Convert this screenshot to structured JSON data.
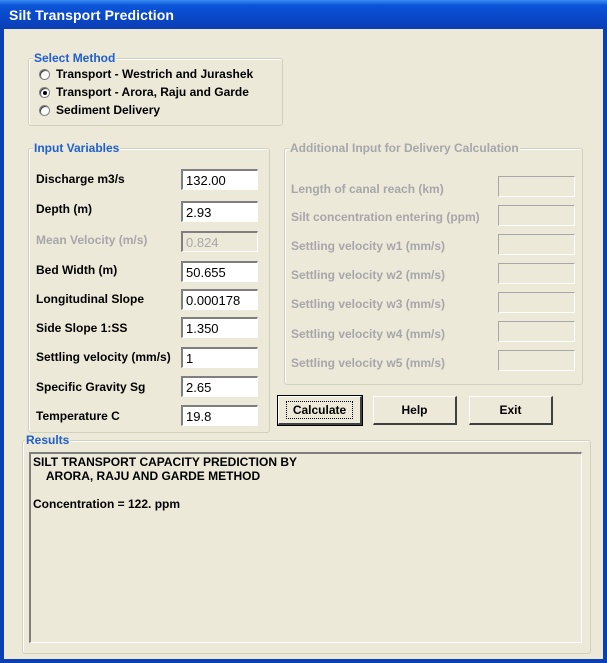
{
  "window": {
    "title": "Silt Transport Prediction"
  },
  "method": {
    "legend": "Select Method",
    "options": [
      {
        "label": "Transport - Westrich and Jurashek",
        "selected": false
      },
      {
        "label": "Transport - Arora, Raju and Garde",
        "selected": true
      },
      {
        "label": "Sediment Delivery",
        "selected": false
      }
    ]
  },
  "inputs": {
    "legend": "Input Variables",
    "fields": [
      {
        "label": "Discharge m3/s",
        "value": "132.00",
        "enabled": true
      },
      {
        "label": "Depth (m)",
        "value": "2.93",
        "enabled": true
      },
      {
        "label": "Mean Velocity (m/s)",
        "value": "0.824",
        "enabled": false
      },
      {
        "label": "Bed Width (m)",
        "value": "50.655",
        "enabled": true
      },
      {
        "label": "Longitudinal Slope",
        "value": "0.000178",
        "enabled": true
      },
      {
        "label": "Side Slope 1:SS",
        "value": "1.350",
        "enabled": true
      },
      {
        "label": "Settling velocity (mm/s)",
        "value": "1",
        "enabled": true
      },
      {
        "label": "Specific Gravity Sg",
        "value": "2.65",
        "enabled": true
      },
      {
        "label": "Temperature C",
        "value": "19.8",
        "enabled": true
      }
    ]
  },
  "delivery": {
    "legend": "Additional Input for Delivery Calculation",
    "fields": [
      {
        "label": "Length of canal reach (km)",
        "value": ""
      },
      {
        "label": "Silt concentration entering (ppm)",
        "value": ""
      },
      {
        "label": "Settling velocity w1 (mm/s)",
        "value": ""
      },
      {
        "label": "Settling velocity w2 (mm/s)",
        "value": ""
      },
      {
        "label": "Settling velocity w3 (mm/s)",
        "value": ""
      },
      {
        "label": "Settling velocity w4 (mm/s)",
        "value": ""
      },
      {
        "label": "Settling velocity w5 (mm/s)",
        "value": ""
      }
    ]
  },
  "buttons": {
    "calculate": "Calculate",
    "help": "Help",
    "exit": "Exit"
  },
  "results": {
    "legend": "Results",
    "text": "SILT TRANSPORT CAPACITY PREDICTION BY\n    ARORA, RAJU AND GARDE METHOD\n\nConcentration = 122. ppm"
  },
  "colors": {
    "titlebar": "#0a47c8",
    "legend": "#1f5fcf",
    "disabled": "#a7a6aa",
    "background": "#ece9d8"
  }
}
